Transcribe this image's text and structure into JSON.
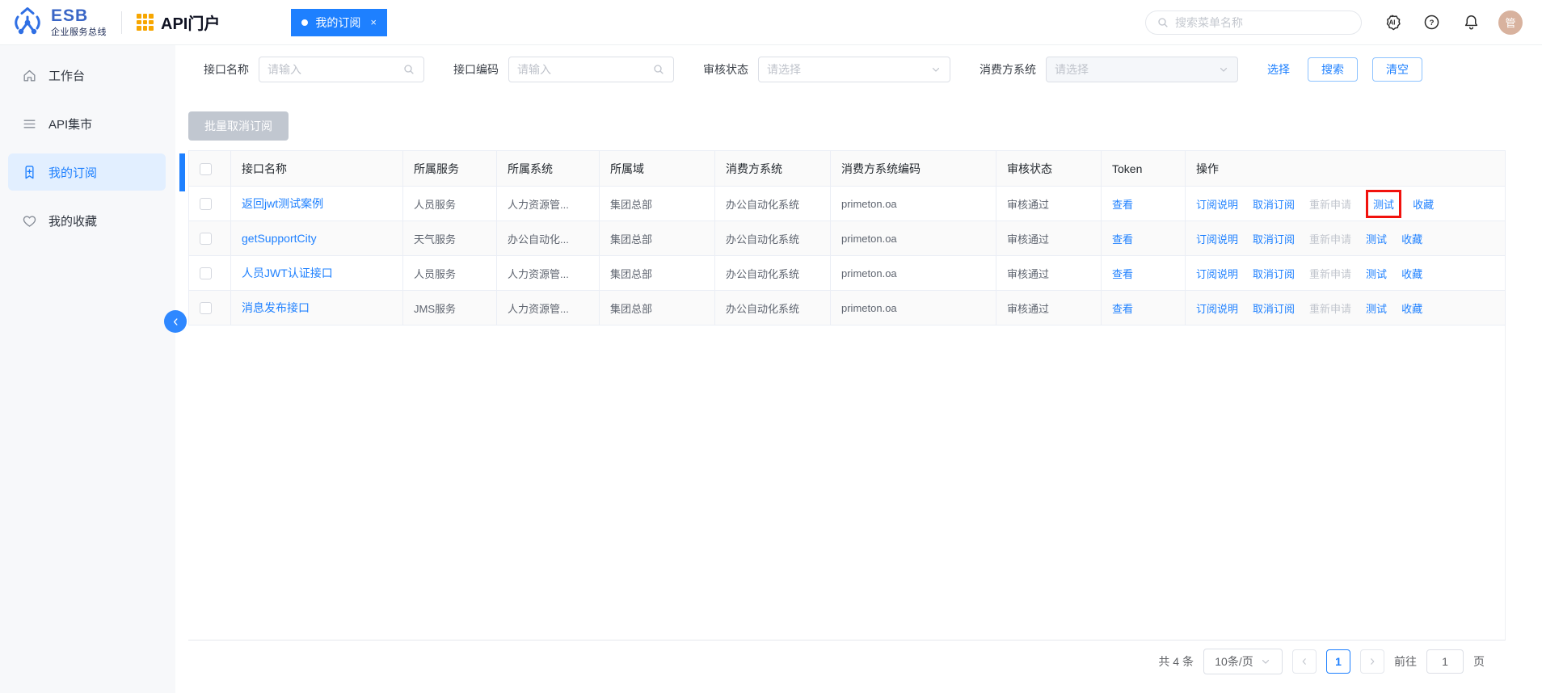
{
  "header": {
    "brand_name": "ESB",
    "brand_subtitle": "企业服务总线",
    "portal_title": "API门户",
    "tab": {
      "label": "我的订阅",
      "close": "×"
    },
    "search_placeholder": "搜索菜单名称",
    "avatar_text": "管"
  },
  "sidebar": {
    "items": [
      {
        "label": "工作台",
        "icon": "home-icon",
        "active": false
      },
      {
        "label": "API集市",
        "icon": "menu-icon",
        "active": false
      },
      {
        "label": "我的订阅",
        "icon": "bookmark-plus-icon",
        "active": true
      },
      {
        "label": "我的收藏",
        "icon": "heart-icon",
        "active": false
      }
    ]
  },
  "filters": {
    "fields": [
      {
        "label": "接口名称",
        "placeholder": "请输入",
        "type": "search-input",
        "disabled": false
      },
      {
        "label": "接口编码",
        "placeholder": "请输入",
        "type": "search-input",
        "disabled": false
      },
      {
        "label": "审核状态",
        "placeholder": "请选择",
        "type": "select",
        "disabled": false
      },
      {
        "label": "消费方系统",
        "placeholder": "请选择",
        "type": "select",
        "disabled": true
      }
    ],
    "choose_link": "选择",
    "search_button": "搜索",
    "clear_button": "清空"
  },
  "toolbar": {
    "batch_unsubscribe_button": "批量取消订阅"
  },
  "table": {
    "columns": [
      "接口名称",
      "所属服务",
      "所属系统",
      "所属域",
      "消费方系统",
      "消费方系统编码",
      "审核状态",
      "Token",
      "操作"
    ],
    "rows": [
      {
        "name": "返回jwt测试案例",
        "service": "人员服务",
        "system": "人力资源管...",
        "domain": "集团总部",
        "consumer": "办公自动化系统",
        "consumer_code": "primeton.oa",
        "status": "审核通过",
        "token_link": "查看"
      },
      {
        "name": "getSupportCity",
        "service": "天气服务",
        "system": "办公自动化...",
        "domain": "集团总部",
        "consumer": "办公自动化系统",
        "consumer_code": "primeton.oa",
        "status": "审核通过",
        "token_link": "查看"
      },
      {
        "name": "人员JWT认证接口",
        "service": "人员服务",
        "system": "人力资源管...",
        "domain": "集团总部",
        "consumer": "办公自动化系统",
        "consumer_code": "primeton.oa",
        "status": "审核通过",
        "token_link": "查看"
      },
      {
        "name": "消息发布接口",
        "service": "JMS服务",
        "system": "人力资源管...",
        "domain": "集团总部",
        "consumer": "办公自动化系统",
        "consumer_code": "primeton.oa",
        "status": "审核通过",
        "token_link": "查看"
      }
    ],
    "row_actions": [
      {
        "label": "订阅说明",
        "disabled": false
      },
      {
        "label": "取消订阅",
        "disabled": false
      },
      {
        "label": "重新申请",
        "disabled": true
      },
      {
        "label": "测试",
        "disabled": false
      },
      {
        "label": "收藏",
        "disabled": false
      }
    ],
    "highlight": {
      "row_index": 0,
      "action_label": "测试"
    }
  },
  "pagination": {
    "total_text": "共 4 条",
    "page_size_text": "10条/页",
    "current_page": "1",
    "goto_label": "前往",
    "goto_value": "1",
    "page_suffix": "页"
  },
  "colors": {
    "primary": "#1e80ff",
    "tab_bg": "#1e80ff",
    "sidebar_active_bg": "#e2efff",
    "disabled_button_bg": "#c1c7d0",
    "disabled_link": "#c2c6ce",
    "highlight_box": "#f1120d",
    "avatar_bg": "#d8b29e",
    "brand_orange": "#f7a600"
  }
}
